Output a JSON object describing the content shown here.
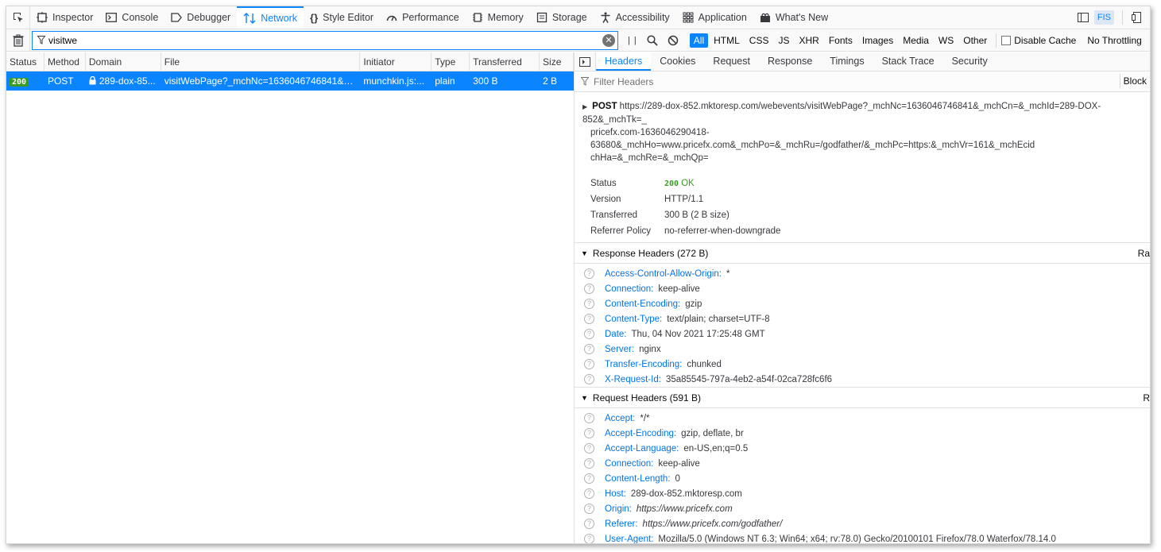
{
  "toolbox": {
    "tabs": [
      {
        "label": "Inspector",
        "icon": "inspector-icon"
      },
      {
        "label": "Console",
        "icon": "console-icon"
      },
      {
        "label": "Debugger",
        "icon": "debugger-icon"
      },
      {
        "label": "Network",
        "icon": "network-icon"
      },
      {
        "label": "Style Editor",
        "icon": "style-editor-icon"
      },
      {
        "label": "Performance",
        "icon": "performance-icon"
      },
      {
        "label": "Memory",
        "icon": "memory-icon"
      },
      {
        "label": "Storage",
        "icon": "storage-icon"
      },
      {
        "label": "Accessibility",
        "icon": "accessibility-icon"
      },
      {
        "label": "Application",
        "icon": "application-icon"
      },
      {
        "label": "What's New",
        "icon": "whats-new-icon"
      }
    ],
    "selected": "Network",
    "fis_label": "FIS"
  },
  "toolbar": {
    "filter_value": "visitwe",
    "types": [
      "All",
      "HTML",
      "CSS",
      "JS",
      "XHR",
      "Fonts",
      "Images",
      "Media",
      "WS",
      "Other"
    ],
    "active_type": "All",
    "disable_cache": "Disable Cache",
    "throttling": "No Throttling"
  },
  "request_table": {
    "columns": [
      "Status",
      "Method",
      "Domain",
      "File",
      "Initiator",
      "Type",
      "Transferred",
      "Size"
    ],
    "rows": [
      {
        "status": "200",
        "method": "POST",
        "domain": "289-dox-85...",
        "file": "visitWebPage?_mchNc=1636046746841&_mc...",
        "initiator": "munchkin.js:...",
        "type": "plain",
        "transferred": "300 B",
        "size": "2 B"
      }
    ]
  },
  "details": {
    "tabs": [
      "Headers",
      "Cookies",
      "Request",
      "Response",
      "Timings",
      "Stack Trace",
      "Security"
    ],
    "selected_tab": "Headers",
    "filter_placeholder": "Filter Headers",
    "block_label": "Block",
    "method": "POST",
    "url_lines": [
      "https://289-dox-852.mktoresp.com/webevents/visitWebPage?_mchNc=1636046746841&_mchCn=&_mchId=289-DOX-852&_mchTk=_",
      "pricefx.com-1636046290418-63680&_mchHo=www.pricefx.com&_mchPo=&_mchRu=/godfather/&_mchPc=https:&_mchVr=161&_mchEcid",
      "chHa=&_mchRe=&_mchQp="
    ],
    "summary": [
      {
        "label": "Status",
        "value": "200",
        "extra": "OK"
      },
      {
        "label": "Version",
        "value": "HTTP/1.1"
      },
      {
        "label": "Transferred",
        "value": "300 B (2 B size)"
      },
      {
        "label": "Referrer Policy",
        "value": "no-referrer-when-downgrade"
      }
    ],
    "response_headers": {
      "title": "Response Headers (272 B)",
      "raw": "Ra",
      "items": [
        {
          "name": "Access-Control-Allow-Origin:",
          "value": "*"
        },
        {
          "name": "Connection:",
          "value": "keep-alive"
        },
        {
          "name": "Content-Encoding:",
          "value": "gzip"
        },
        {
          "name": "Content-Type:",
          "value": "text/plain; charset=UTF-8"
        },
        {
          "name": "Date:",
          "value": "Thu, 04 Nov 2021 17:25:48 GMT"
        },
        {
          "name": "Server:",
          "value": "nginx"
        },
        {
          "name": "Transfer-Encoding:",
          "value": "chunked"
        },
        {
          "name": "X-Request-Id:",
          "value": "35a85545-797a-4eb2-a54f-02ca728fc6f6"
        }
      ]
    },
    "request_headers": {
      "title": "Request Headers (591 B)",
      "raw": "R",
      "items": [
        {
          "name": "Accept:",
          "value": "*/*"
        },
        {
          "name": "Accept-Encoding:",
          "value": "gzip, deflate, br"
        },
        {
          "name": "Accept-Language:",
          "value": "en-US,en;q=0.5"
        },
        {
          "name": "Connection:",
          "value": "keep-alive"
        },
        {
          "name": "Content-Length:",
          "value": "0"
        },
        {
          "name": "Host:",
          "value": "289-dox-852.mktoresp.com"
        },
        {
          "name": "Origin:",
          "value": "https://www.pricefx.com",
          "italic": true
        },
        {
          "name": "Referer:",
          "value": "https://www.pricefx.com/godfather/",
          "italic": true
        },
        {
          "name": "User-Agent:",
          "value": "Mozilla/5.0 (Windows NT 6.3; Win64; x64; rv:78.0) Gecko/20100101 Firefox/78.0 Waterfox/78.14.0"
        }
      ]
    }
  }
}
